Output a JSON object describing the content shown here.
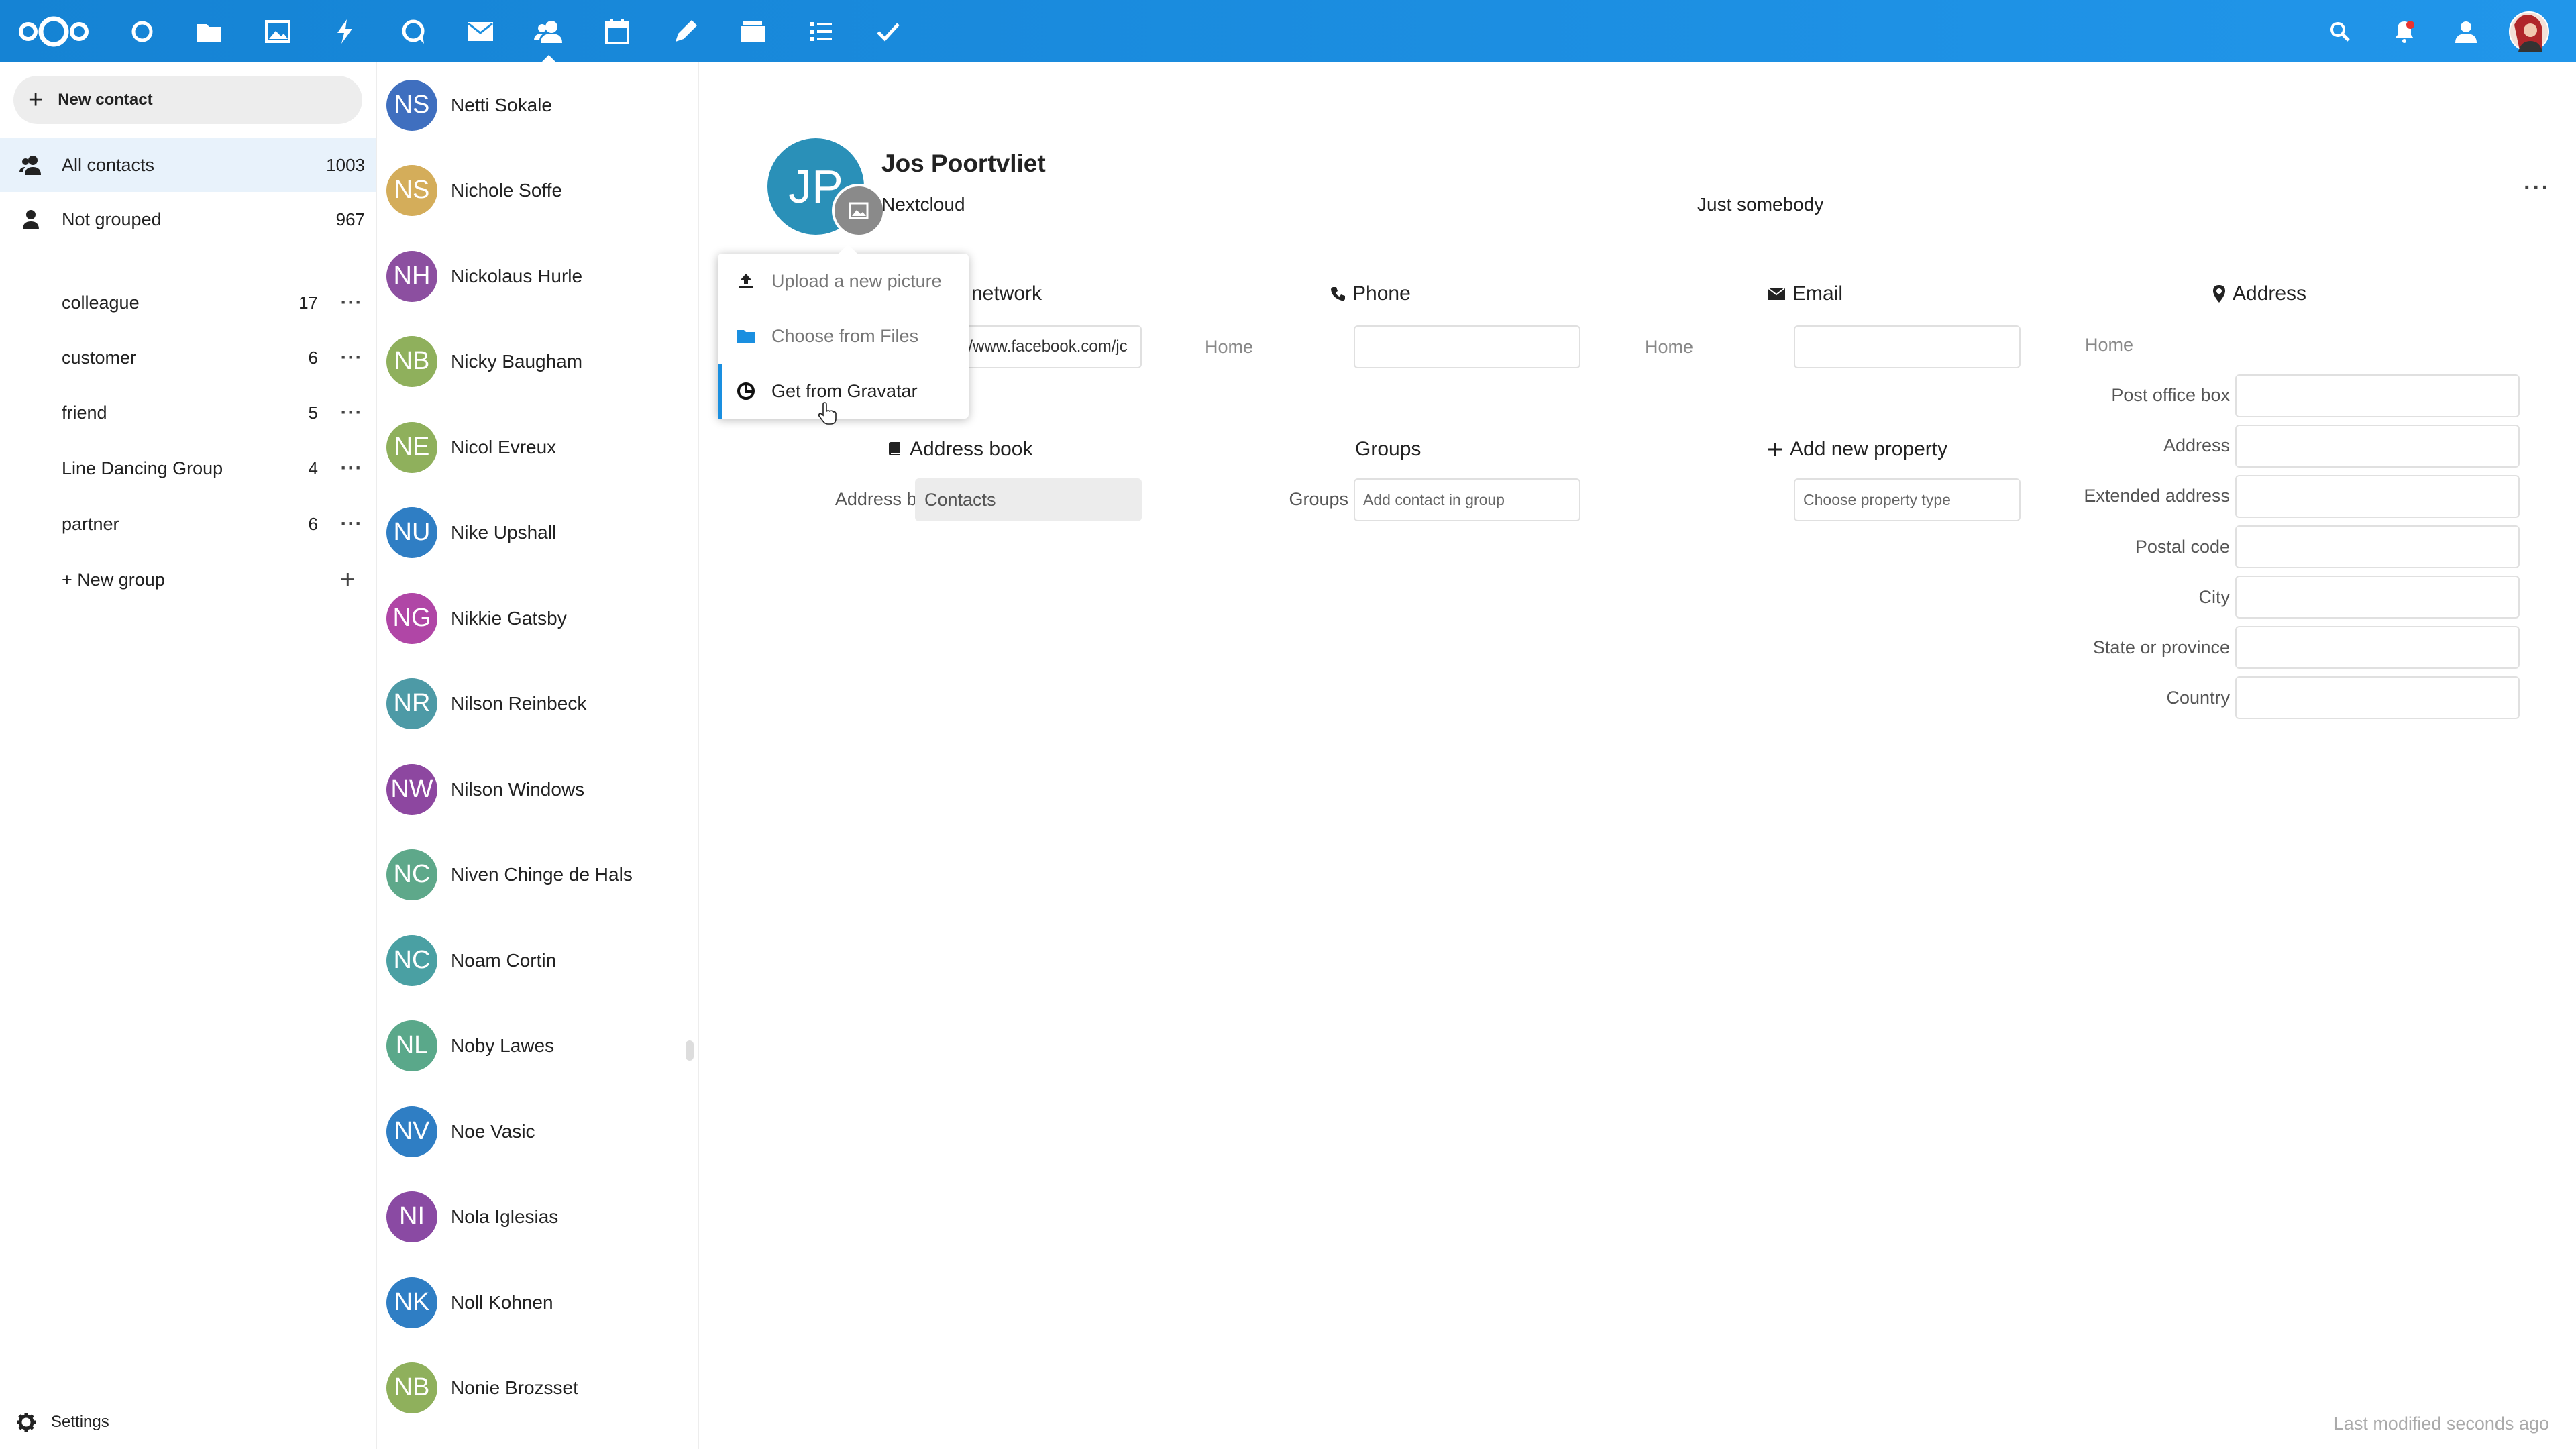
{
  "colors": {
    "header": "#1a8fe0",
    "active_nav": "#e8f2fb",
    "accent": "#1a8fe0"
  },
  "header": {
    "apps": [
      "nextcloud-logo",
      "dashboard-icon",
      "files-icon",
      "photos-icon",
      "activity-icon",
      "talk-icon",
      "mail-icon",
      "contacts-icon",
      "calendar-icon",
      "notes-icon",
      "deck-icon",
      "checklist-icon",
      "tasks-icon"
    ],
    "right": [
      "search-icon",
      "notifications-icon",
      "contacts-menu-icon",
      "user-avatar"
    ]
  },
  "nav": {
    "new_contact": "New contact",
    "all_contacts": {
      "label": "All contacts",
      "count": "1003"
    },
    "not_grouped": {
      "label": "Not grouped",
      "count": "967"
    },
    "groups": [
      {
        "label": "colleague",
        "count": "17"
      },
      {
        "label": "customer",
        "count": "6"
      },
      {
        "label": "friend",
        "count": "5"
      },
      {
        "label": "Line Dancing Group",
        "count": "4"
      },
      {
        "label": "partner",
        "count": "6"
      }
    ],
    "new_group": "+ New group",
    "settings": "Settings"
  },
  "contacts": [
    {
      "initials": "NS",
      "name": "Netti Sokale",
      "color": "#3f6fbf"
    },
    {
      "initials": "NS",
      "name": "Nichole Soffe",
      "color": "#d4ad5a"
    },
    {
      "initials": "NH",
      "name": "Nickolaus Hurle",
      "color": "#8c4fa0"
    },
    {
      "initials": "NB",
      "name": "Nicky Baugham",
      "color": "#8fb05c"
    },
    {
      "initials": "NE",
      "name": "Nicol Evreux",
      "color": "#8fb05c"
    },
    {
      "initials": "NU",
      "name": "Nike Upshall",
      "color": "#2f7ec4"
    },
    {
      "initials": "NG",
      "name": "Nikkie Gatsby",
      "color": "#b046a6"
    },
    {
      "initials": "NR",
      "name": "Nilson Reinbeck",
      "color": "#4d9aa6"
    },
    {
      "initials": "NW",
      "name": "Nilson Windows",
      "color": "#8d47a0"
    },
    {
      "initials": "NC",
      "name": "Niven Chinge de Hals",
      "color": "#5ea88a"
    },
    {
      "initials": "NC",
      "name": "Noam Cortin",
      "color": "#4aa0a3"
    },
    {
      "initials": "NL",
      "name": "Noby Lawes",
      "color": "#5aa88a"
    },
    {
      "initials": "NV",
      "name": "Noe Vasic",
      "color": "#2f7ec4"
    },
    {
      "initials": "NI",
      "name": "Nola Iglesias",
      "color": "#8a4aa3"
    },
    {
      "initials": "NK",
      "name": "Noll Kohnen",
      "color": "#2f7ec4"
    },
    {
      "initials": "NB",
      "name": "Nonie Brozsset",
      "color": "#8fb05c"
    }
  ],
  "detail": {
    "initials": "JP",
    "name": "Jos Poortvliet",
    "org": "Nextcloud",
    "title": "Just somebody",
    "social": {
      "heading": "network",
      "value": "://www.facebook.com/jc"
    },
    "phone": {
      "heading": "Phone",
      "label": "Home",
      "value": ""
    },
    "email": {
      "heading": "Email",
      "label": "Home",
      "value": ""
    },
    "address": {
      "heading": "Address",
      "type": "Home",
      "fields": [
        "Post office box",
        "Address",
        "Extended address",
        "Postal code",
        "City",
        "State or province",
        "Country"
      ]
    },
    "addressbook": {
      "heading": "Address book",
      "label": "Address book",
      "value": "Contacts"
    },
    "groups": {
      "heading": "Groups",
      "label": "Groups",
      "placeholder": "Add contact in group"
    },
    "add_property": {
      "heading": "Add new property",
      "placeholder": "Choose property type"
    },
    "last_modified": "Last modified seconds ago"
  },
  "picture_menu": {
    "items": [
      "Upload a new picture",
      "Choose from Files",
      "Get from Gravatar"
    ]
  }
}
